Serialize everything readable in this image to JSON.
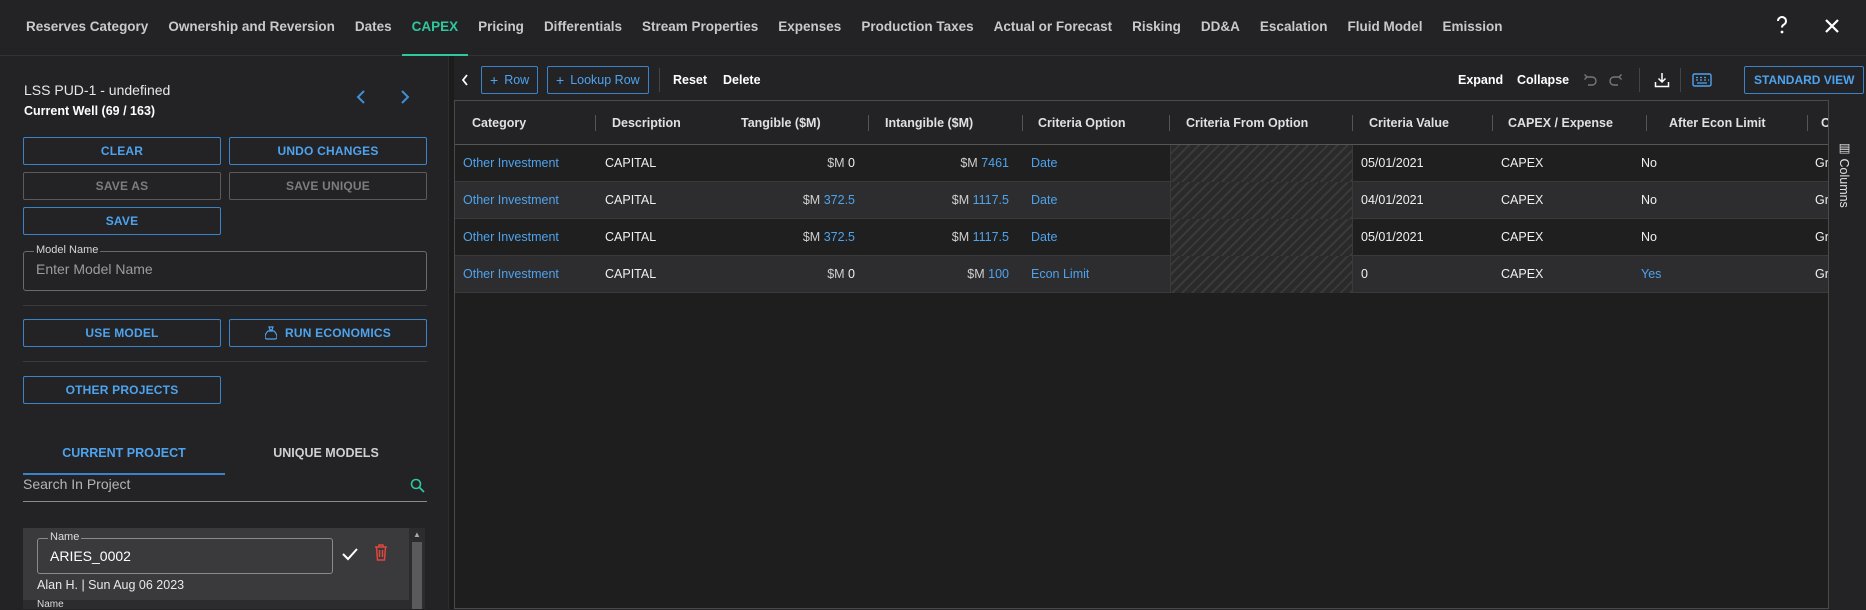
{
  "tabs": [
    "Reserves Category",
    "Ownership and Reversion",
    "Dates",
    "CAPEX",
    "Pricing",
    "Differentials",
    "Stream Properties",
    "Expenses",
    "Production Taxes",
    "Actual or Forecast",
    "Risking",
    "DD&A",
    "Escalation",
    "Fluid Model",
    "Emission"
  ],
  "active_tab": "CAPEX",
  "top_icons": {
    "help": "?",
    "close": "✕"
  },
  "left": {
    "well_title": "LSS PUD-1 - undefined",
    "well_sub": "Current Well (69 / 163)",
    "buttons": {
      "clear": "CLEAR",
      "undo": "UNDO CHANGES",
      "save_as": "SAVE AS",
      "save_unique": "SAVE UNIQUE",
      "save": "SAVE",
      "use_model": "USE MODEL",
      "run_economics": "RUN ECONOMICS",
      "other_projects": "OTHER PROJECTS"
    },
    "model_name": {
      "label": "Model Name",
      "placeholder": "Enter Model Name"
    },
    "subtabs": {
      "current": "CURRENT PROJECT",
      "unique": "UNIQUE MODELS"
    },
    "search_placeholder": "Search In Project",
    "card": {
      "label": "Name",
      "value": "ARIES_0002",
      "meta": "Alan H. | Sun Aug 06 2023"
    },
    "card2_label": "Name"
  },
  "toolbar": {
    "row": "Row",
    "lookup_row": "Lookup Row",
    "reset": "Reset",
    "delete": "Delete",
    "expand": "Expand",
    "collapse": "Collapse",
    "standard_view": "STANDARD VIEW"
  },
  "grid": {
    "headers": [
      "Category",
      "Description",
      "Tangible ($M)",
      "Intangible ($M)",
      "Criteria Option",
      "Criteria From Option",
      "Criteria Value",
      "CAPEX / Expense",
      "After Econ Limit",
      "C"
    ],
    "rows": [
      {
        "category": "Other Investment",
        "description": "CAPITAL",
        "tangible_unit": "$M",
        "tangible": "0",
        "intangible_unit": "$M",
        "intangible": "7461",
        "criteria_option": "Date",
        "criteria_value": "05/01/2021",
        "capex_expense": "CAPEX",
        "after_econ": "No",
        "last": "Gr"
      },
      {
        "category": "Other Investment",
        "description": "CAPITAL",
        "tangible_unit": "$M",
        "tangible": "372.5",
        "intangible_unit": "$M",
        "intangible": "1117.5",
        "criteria_option": "Date",
        "criteria_value": "04/01/2021",
        "capex_expense": "CAPEX",
        "after_econ": "No",
        "last": "Gr"
      },
      {
        "category": "Other Investment",
        "description": "CAPITAL",
        "tangible_unit": "$M",
        "tangible": "372.5",
        "intangible_unit": "$M",
        "intangible": "1117.5",
        "criteria_option": "Date",
        "criteria_value": "05/01/2021",
        "capex_expense": "CAPEX",
        "after_econ": "No",
        "last": "Gr"
      },
      {
        "category": "Other Investment",
        "description": "CAPITAL",
        "tangible_unit": "$M",
        "tangible": "0",
        "intangible_unit": "$M",
        "intangible": "100",
        "criteria_option": "Econ Limit",
        "criteria_value": "0",
        "capex_expense": "CAPEX",
        "after_econ": "Yes",
        "last": "Gr"
      }
    ]
  },
  "side_strip": {
    "columns": "Columns"
  }
}
